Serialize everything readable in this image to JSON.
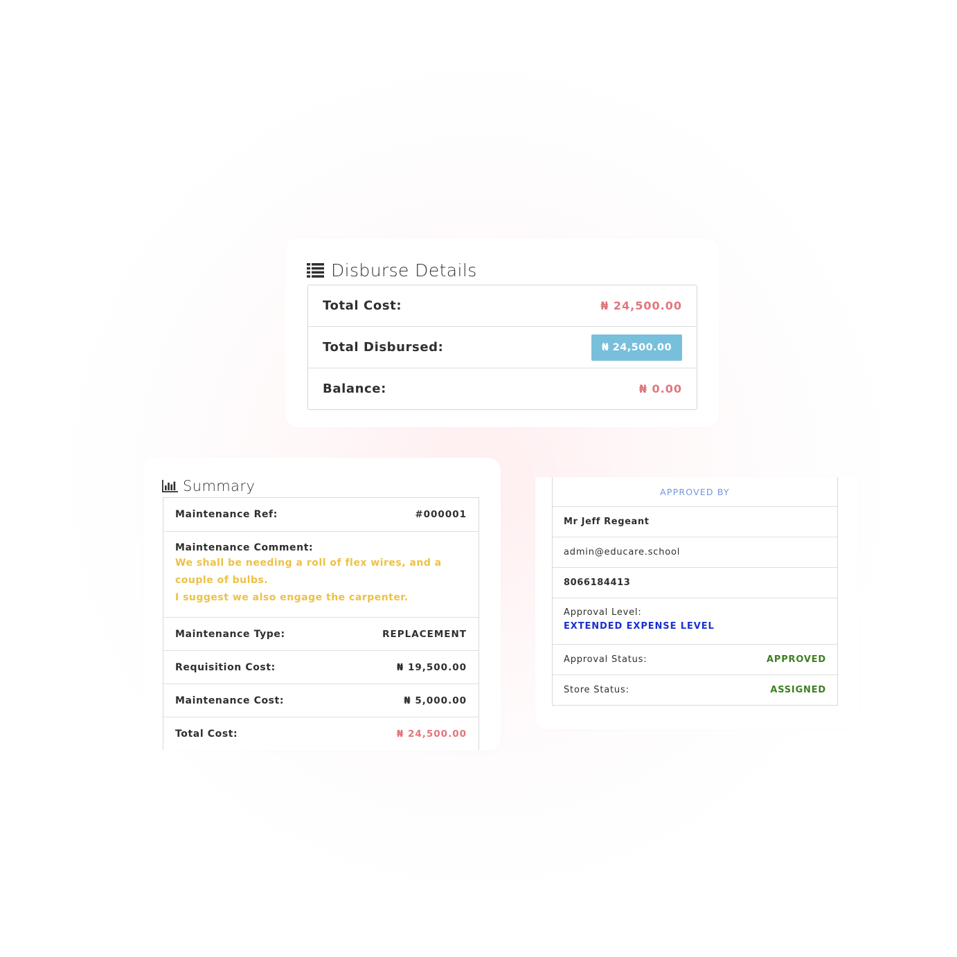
{
  "disburse": {
    "title": "Disburse Details",
    "title_icon": "list-icon",
    "rows": [
      {
        "label": "Total Cost:",
        "value": "₦ 24,500.00"
      },
      {
        "label": "Total Disbursed:",
        "value": "₦ 24,500.00"
      },
      {
        "label": "Balance:",
        "value": "₦ 0.00"
      }
    ]
  },
  "summary": {
    "title": "Summary",
    "title_icon": "bar-chart-icon",
    "maintenance_ref": {
      "label": "Maintenance Ref:",
      "value": "#000001"
    },
    "maintenance_comment": {
      "label": "Maintenance Comment:",
      "lines": [
        "We shall be needing a roll of flex wires, and a couple of bulbs.",
        "I suggest we also engage the carpenter."
      ]
    },
    "maintenance_type": {
      "label": "Maintenance Type:",
      "value": "REPLACEMENT"
    },
    "requisition_cost": {
      "label": "Requisition Cost:",
      "value": "₦ 19,500.00"
    },
    "maintenance_cost": {
      "label": "Maintenance Cost:",
      "value": "₦ 5,000.00"
    },
    "total_cost": {
      "label": "Total Cost:",
      "value": "₦ 24,500.00"
    }
  },
  "approval": {
    "header": "APPROVED BY",
    "name": "Mr Jeff Regeant",
    "email": "admin@educare.school",
    "phone": "8066184413",
    "level": {
      "label": "Approval Level:",
      "value": "EXTENDED EXPENSE LEVEL"
    },
    "status": {
      "label": "Approval Status:",
      "value": "APPROVED"
    },
    "store_status": {
      "label": "Store Status:",
      "value": "ASSIGNED"
    }
  },
  "colors": {
    "accent_red": "#e0767e",
    "badge_blue": "#78bfdc",
    "comment_yellow": "#edc145",
    "status_green": "#3e7f22",
    "level_blue": "#1a2fd0",
    "header_blue": "#6f95d9"
  }
}
